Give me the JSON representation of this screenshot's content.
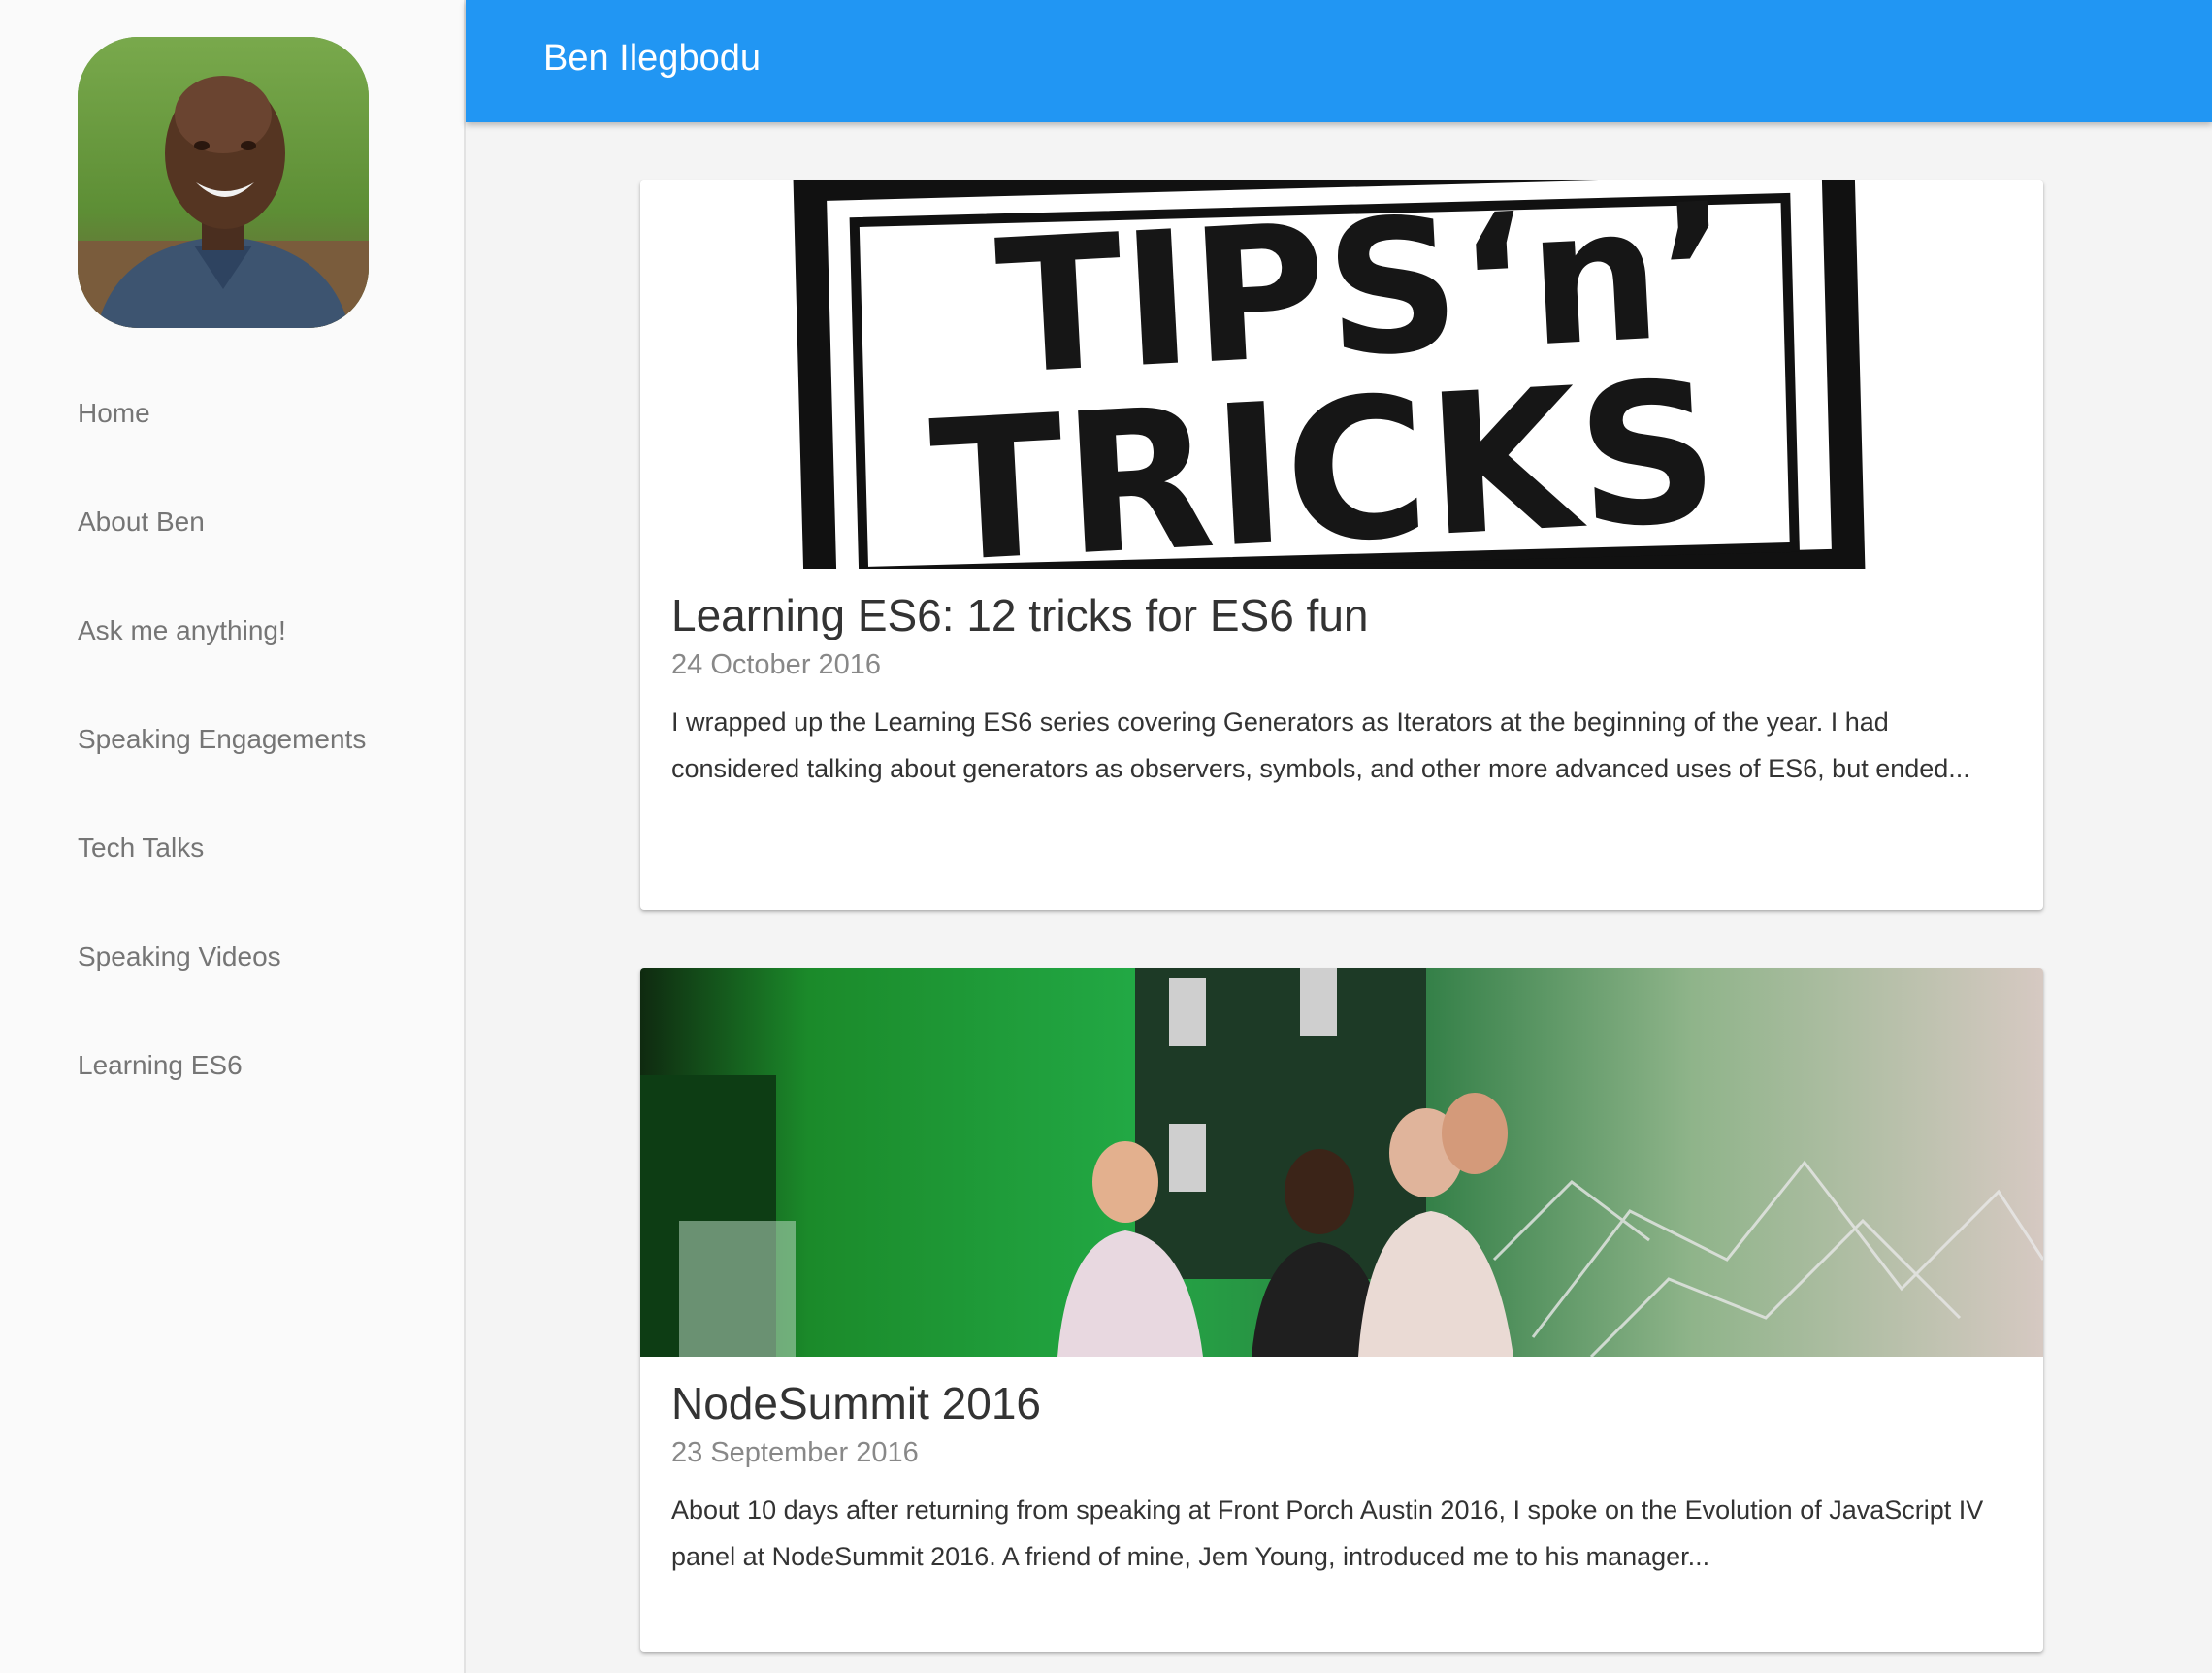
{
  "header": {
    "title": "Ben Ilegbodu"
  },
  "sidebar": {
    "avatar_alt": "Ben Ilegbodu",
    "items": [
      {
        "label": "Home"
      },
      {
        "label": "About Ben"
      },
      {
        "label": "Ask me anything!"
      },
      {
        "label": "Speaking Engagements"
      },
      {
        "label": "Tech Talks"
      },
      {
        "label": "Speaking Videos"
      },
      {
        "label": "Learning ES6"
      }
    ]
  },
  "posts": [
    {
      "title": "Learning ES6: 12 tricks for ES6 fun",
      "date": "24 October 2016",
      "excerpt": "I wrapped up the Learning ES6 series covering Generators as Iterators at the beginning of the year. I had considered talking about generators as observers, symbols, and other more advanced uses of ES6, but ended...",
      "image_text_line1": "TIPS‘n’",
      "image_text_line2": "TRICKS"
    },
    {
      "title": "NodeSummit 2016",
      "date": "23 September 2016",
      "excerpt": "About 10 days after returning from speaking at Front Porch Austin 2016, I spoke on the Evolution of JavaScript IV panel at NodeSummit 2016. A friend of mine, Jem Young, introduced me to his manager..."
    }
  ],
  "colors": {
    "header_bg": "#2196f3",
    "sidebar_bg": "#fafafa",
    "page_bg": "#f4f4f4",
    "nav_text": "#757575",
    "title_text": "#333333",
    "date_text": "#888888"
  }
}
